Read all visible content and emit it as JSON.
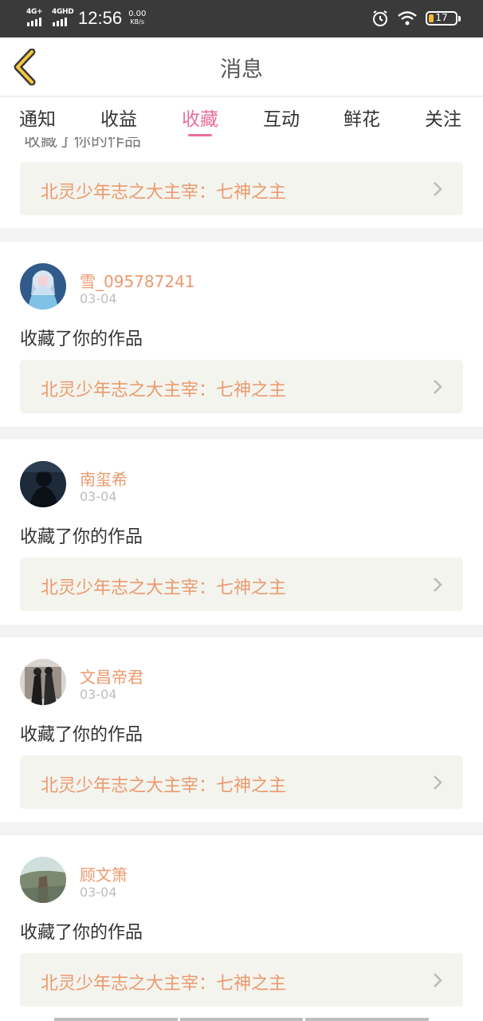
{
  "status_bar": {
    "net1": "4G+",
    "net2": "4GHD",
    "time": "12:56",
    "speed_value": "0.00",
    "speed_unit": "KB/s",
    "battery": "17",
    "icons": [
      "alarm-icon",
      "wifi-icon",
      "battery-icon"
    ]
  },
  "header": {
    "title": "消息"
  },
  "tabs": [
    {
      "label": "通知"
    },
    {
      "label": "收益"
    },
    {
      "label": "收藏",
      "active": true
    },
    {
      "label": "互动"
    },
    {
      "label": "鲜花"
    },
    {
      "label": "关注"
    }
  ],
  "colors": {
    "accent": "#ea6f9a",
    "name": "#eb9a6f",
    "work_bg": "#f4f4ee",
    "status_bar": "#3a3a3a"
  },
  "partial_card": {
    "action": "收藏了你的作品",
    "work_title": "北灵少年志之大主宰：七神之主"
  },
  "messages": [
    {
      "user": "雪_095787241",
      "date": "03-04",
      "action": "收藏了你的作品",
      "work_title": "北灵少年志之大主宰：七神之主"
    },
    {
      "user": "南玺希",
      "date": "03-04",
      "action": "收藏了你的作品",
      "work_title": "北灵少年志之大主宰：七神之主"
    },
    {
      "user": "文昌帝君",
      "date": "03-04",
      "action": "收藏了你的作品",
      "work_title": "北灵少年志之大主宰：七神之主"
    },
    {
      "user": "顾文箫",
      "date": "03-04",
      "action": "收藏了你的作品",
      "work_title": "北灵少年志之大主宰：七神之主"
    }
  ]
}
